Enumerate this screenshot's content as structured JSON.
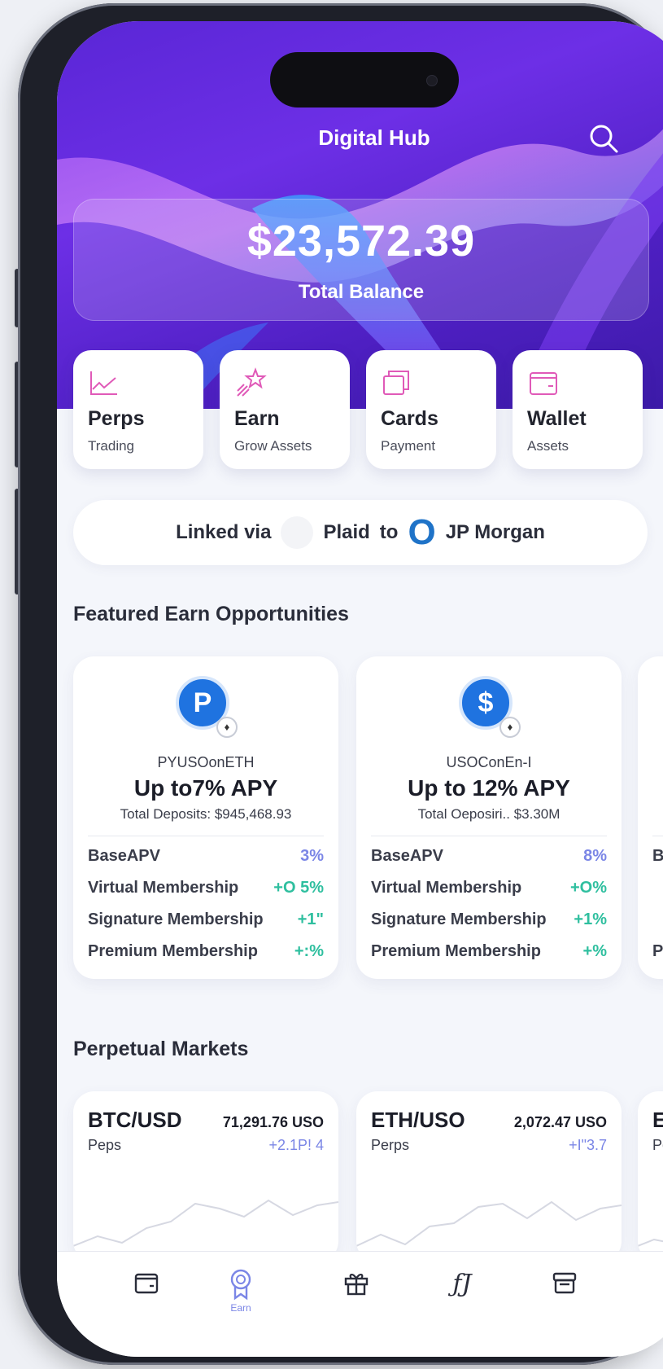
{
  "header": {
    "title": "Digital Hub"
  },
  "balance": {
    "amount": "$23,572.39",
    "label": "Total Balance"
  },
  "tiles": [
    {
      "label": "Perps",
      "sub": "Trading",
      "icon": "chart-line-icon"
    },
    {
      "label": "Earn",
      "sub": "Grow Assets",
      "icon": "sparkle-star-icon"
    },
    {
      "label": "Cards",
      "sub": "Payment",
      "icon": "cards-icon"
    },
    {
      "label": "Wallet",
      "sub": "Assets",
      "icon": "wallet-icon"
    }
  ],
  "linked": {
    "prefix": "Linked via",
    "provider": "Plaid",
    "to": "to",
    "bank_logo": "O",
    "bank": "JP Morgan"
  },
  "featured": {
    "title": "Featured Earn Opportunities",
    "cards": [
      {
        "coin_symbol": "P",
        "name": "PYUSOonETH",
        "apy": "Up to7% APY",
        "deposits": "Total Deposits: $945,468.93",
        "rows": [
          {
            "label": "BaseAPV",
            "value": "3%"
          },
          {
            "label": "Virtual Membership",
            "value": "+O 5%"
          },
          {
            "label": "Signature Membership",
            "value": "+1\""
          },
          {
            "label": "Premium Membership",
            "value": "+:%"
          }
        ]
      },
      {
        "coin_symbol": "$",
        "name": "USOConEn-I",
        "apy": "Up to 12% APY",
        "deposits": "Total Oeposiri.. $3.30M",
        "rows": [
          {
            "label": "BaseAPV",
            "value": "8%"
          },
          {
            "label": "Virtual Membership",
            "value": "+O%"
          },
          {
            "label": "Signature Membership",
            "value": "+1%"
          },
          {
            "label": "Premium Membership",
            "value": "+%"
          }
        ]
      },
      {
        "rows": [
          {
            "label": "Ba"
          },
          {
            "label": "Pr"
          }
        ]
      }
    ]
  },
  "perpetual": {
    "title": "Perpetual Markets",
    "cards": [
      {
        "pair": "BTC/USD",
        "sub": "Peps",
        "price": "71,291.76 USO",
        "change": "+2.1P! 4"
      },
      {
        "pair": "ETH/USO",
        "sub": "Perps",
        "price": "2,072.47 USO",
        "change": "+I\"3.7"
      },
      {
        "pair": "ET",
        "sub": "Per"
      }
    ]
  },
  "nav": [
    {
      "icon": "wallet-icon",
      "label": ""
    },
    {
      "icon": "earn-badge-icon",
      "label": "Earn"
    },
    {
      "icon": "gift-icon",
      "label": ""
    },
    {
      "icon": "fj-glyph-icon",
      "label": "",
      "glyph": "ƒJ"
    },
    {
      "icon": "store-icon",
      "label": ""
    }
  ],
  "colors": {
    "hero": "#5a26d6",
    "accent_pink": "#e05ab8",
    "accent_blue": "#7b86e6",
    "accent_green": "#2fbf9f",
    "coin_blue": "#1f73e0"
  }
}
